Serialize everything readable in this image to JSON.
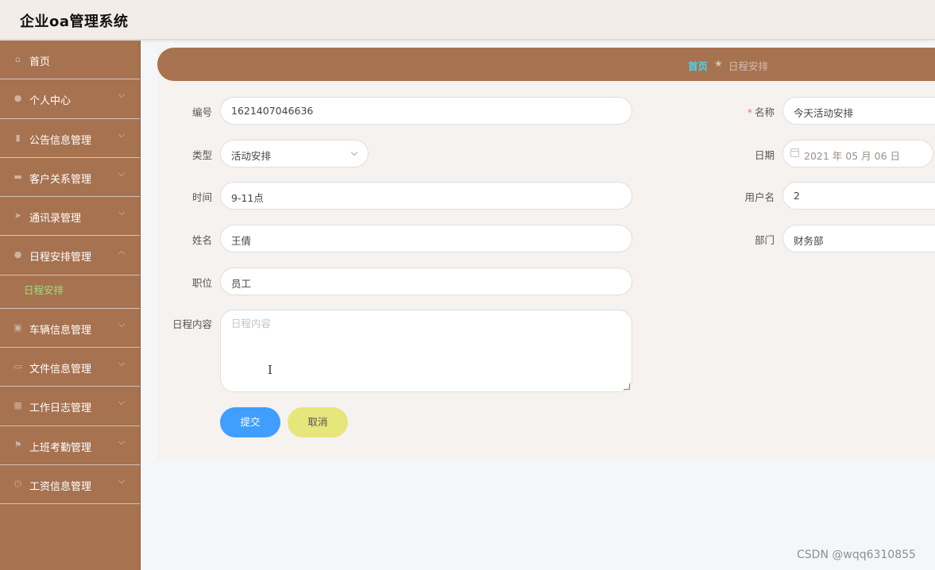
{
  "app": {
    "title": "企业oa管理系统"
  },
  "sidebar": {
    "items": [
      {
        "label": "首页",
        "icon": "home-icon",
        "has_arrow": false
      },
      {
        "label": "个人中心",
        "icon": "user-icon",
        "has_arrow": true
      },
      {
        "label": "公告信息管理",
        "icon": "bar-chart-icon",
        "has_arrow": true
      },
      {
        "label": "客户关系管理",
        "icon": "monitor-icon",
        "has_arrow": true
      },
      {
        "label": "通讯录管理",
        "icon": "send-icon",
        "has_arrow": true
      },
      {
        "label": "日程安排管理",
        "icon": "user-icon",
        "has_arrow": true,
        "expanded": true
      },
      {
        "label": "车辆信息管理",
        "icon": "clipboard-icon",
        "has_arrow": true
      },
      {
        "label": "文件信息管理",
        "icon": "message-icon",
        "has_arrow": true
      },
      {
        "label": "工作日志管理",
        "icon": "grid-icon",
        "has_arrow": true
      },
      {
        "label": "上班考勤管理",
        "icon": "flag-icon",
        "has_arrow": true
      },
      {
        "label": "工资信息管理",
        "icon": "power-icon",
        "has_arrow": true
      }
    ],
    "sub_item": "日程安排"
  },
  "breadcrumb": {
    "home": "首页",
    "separator": "★",
    "current": "日程安排"
  },
  "form": {
    "bianhao": {
      "label": "编号",
      "value": "1621407046636"
    },
    "mingcheng": {
      "label": "名称",
      "required_mark": "*",
      "value": "今天活动安排"
    },
    "leixing": {
      "label": "类型",
      "value": "活动安排"
    },
    "riqi": {
      "label": "日期",
      "value": "2021 年 05 月 06 日"
    },
    "shijian": {
      "label": "时间",
      "value": "9-11点"
    },
    "yonghuming": {
      "label": "用户名",
      "value": "2"
    },
    "xingming": {
      "label": "姓名",
      "value": "王倩"
    },
    "bumen": {
      "label": "部门",
      "value": "财务部"
    },
    "zhiwei": {
      "label": "职位",
      "value": "员工"
    },
    "neirong": {
      "label": "日程内容",
      "placeholder": "日程内容"
    }
  },
  "buttons": {
    "submit": "提交",
    "cancel": "取消"
  },
  "watermark": "CSDN @wqq6310855",
  "colors": {
    "sidebar": "#a77250",
    "accent_link": "#52d1e8",
    "submit": "#409eff",
    "cancel": "#e6e67a",
    "sub_active": "#9be07a"
  }
}
